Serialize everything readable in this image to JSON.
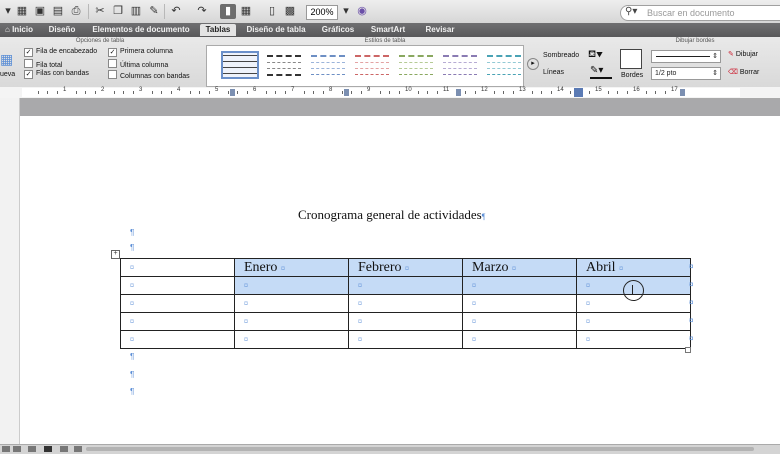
{
  "toolbar": {
    "zoom": "200%",
    "search_placeholder": "Buscar en documento"
  },
  "tabs": [
    "Inicio",
    "Diseño",
    "Elementos de documento",
    "Tablas",
    "Diseño de tabla",
    "Gráficos",
    "SmartArt",
    "Revisar"
  ],
  "ribbon": {
    "options_title": "Opciones de tabla",
    "options": [
      {
        "label": "Fila de encabezado",
        "checked": true
      },
      {
        "label": "Fila total",
        "checked": false
      },
      {
        "label": "Filas con bandas",
        "checked": true
      },
      {
        "label": "Primera columna",
        "checked": true
      },
      {
        "label": "Última columna",
        "checked": false
      },
      {
        "label": "Columnas con bandas",
        "checked": false
      }
    ],
    "new_label": "ueva",
    "styles_title": "Estilos de tabla",
    "shading_label": "Sombreado",
    "lines_label": "Líneas",
    "borders_label": "Bordes",
    "draw_borders_title": "Dibujar bordes",
    "line_weight": "1/2 pto",
    "draw_label": "Dibujar",
    "erase_label": "Borrar"
  },
  "ruler_numbers": [
    "1",
    "2",
    "3",
    "4",
    "5",
    "6",
    "7",
    "8",
    "9",
    "10",
    "11",
    "12",
    "13",
    "14",
    "15",
    "16",
    "17"
  ],
  "document": {
    "title": "Cronograma general de actividades",
    "pilcrow": "¶",
    "cell_marker": "¤",
    "table": {
      "headers": [
        "",
        "Enero",
        "Febrero",
        "Marzo",
        "Abril"
      ],
      "body_rows": 4
    }
  }
}
